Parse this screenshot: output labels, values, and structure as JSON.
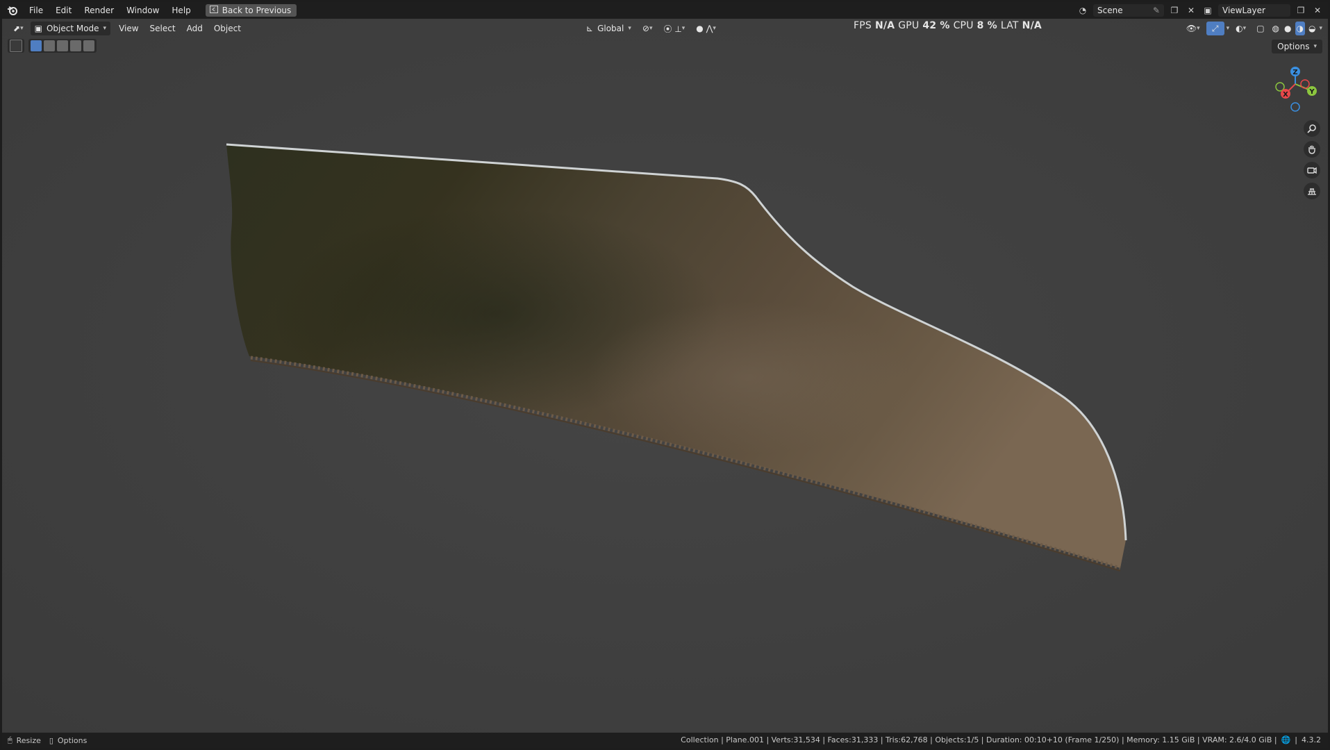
{
  "menu": {
    "file": "File",
    "edit": "Edit",
    "render": "Render",
    "window": "Window",
    "help": "Help"
  },
  "back_button": "Back to Previous",
  "scene": "Scene",
  "view_layer": "ViewLayer",
  "header": {
    "mode": "Object Mode",
    "view": "View",
    "select": "Select",
    "add": "Add",
    "object": "Object",
    "transform_orientation": "Global"
  },
  "stats": {
    "fps_label": "FPS",
    "fps_value": "N/A",
    "gpu_label": "GPU",
    "gpu_value": "42 %",
    "cpu_label": "CPU",
    "cpu_value": "8 %",
    "lat_label": "LAT",
    "lat_value": "N/A"
  },
  "options_label": "Options",
  "gizmo": {
    "x": "X",
    "y": "Y",
    "z": "Z"
  },
  "status": {
    "resize": "Resize",
    "options": "Options",
    "info": "Collection | Plane.001 | Verts:31,534 | Faces:31,333 | Tris:62,768 | Objects:1/5 | Duration: 00:10+10 (Frame 1/250) | Memory: 1.15 GiB | VRAM: 2.6/4.0 GiB |",
    "version": "4.3.2"
  },
  "colors": {
    "axis_x": "#e8484a",
    "axis_y": "#8cc63f",
    "axis_z": "#3a8fe0",
    "active_blue": "#4f7ec2"
  },
  "icons": [
    "blender-logo-icon",
    "editor-type-icon",
    "object-mode-icon",
    "orientation-icon",
    "pivot-icon",
    "snap-icon",
    "proportional-icon",
    "visibility-icon",
    "gizmo-icon",
    "overlay-icon",
    "xray-icon",
    "shading-wireframe-icon",
    "shading-solid-icon",
    "shading-material-icon",
    "shading-rendered-icon",
    "zoom-icon",
    "hand-icon",
    "camera-icon",
    "grid-icon",
    "globe-icon"
  ]
}
